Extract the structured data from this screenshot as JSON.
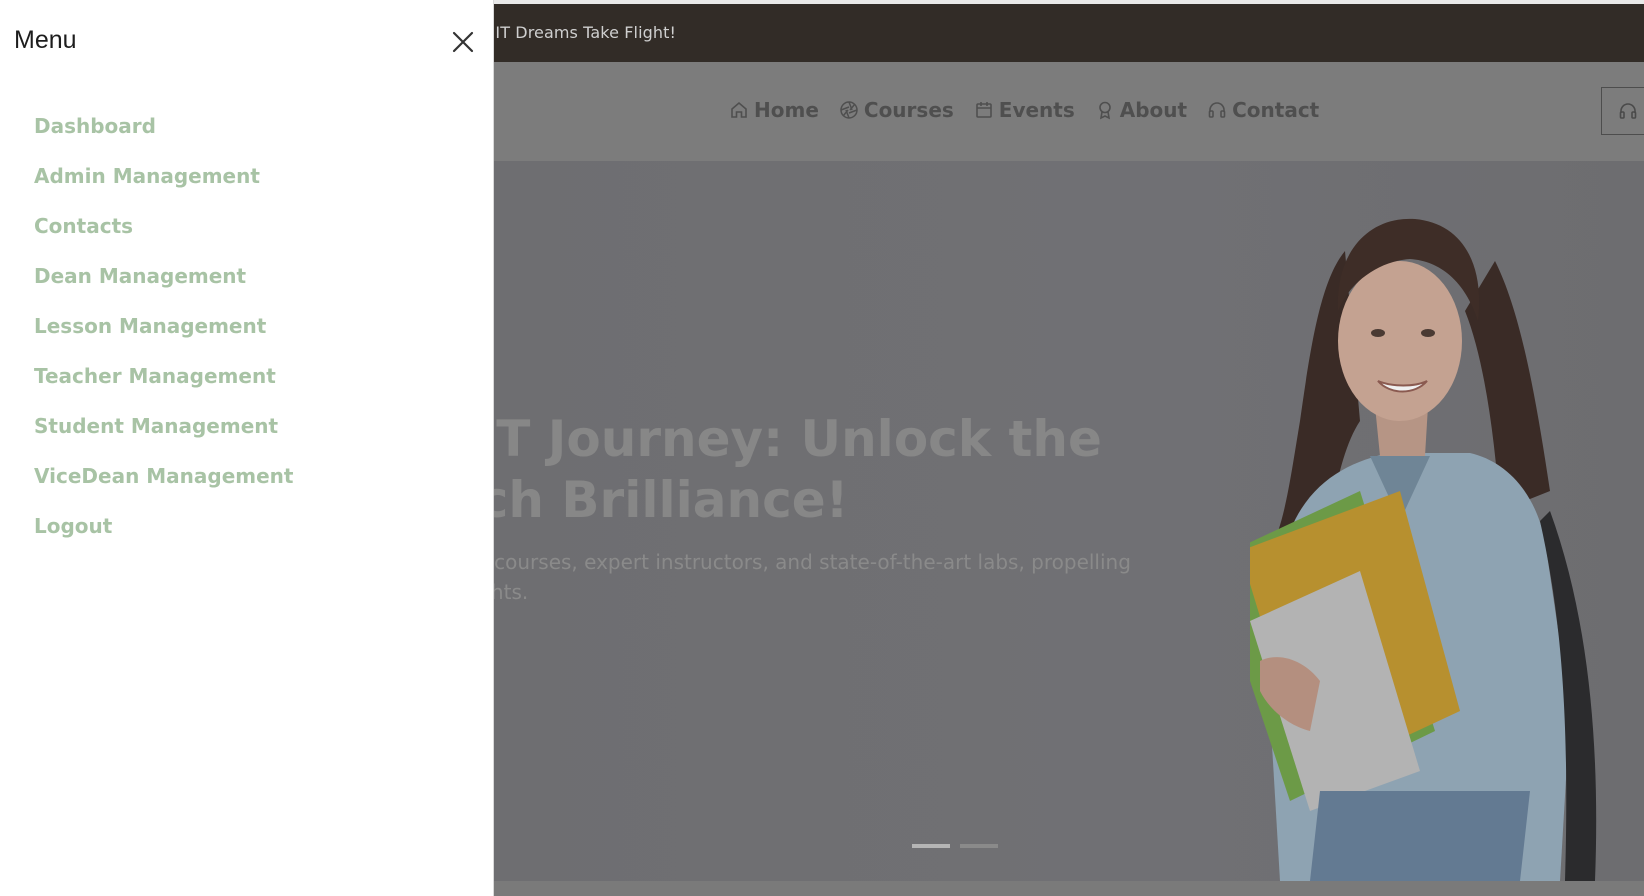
{
  "topbar": {
    "tagline": "ere IT Dreams Take Flight!"
  },
  "nav": {
    "items": [
      {
        "label": "Home",
        "icon": "home-icon"
      },
      {
        "label": "Courses",
        "icon": "aperture-icon"
      },
      {
        "label": "Events",
        "icon": "calendar-icon"
      },
      {
        "label": "About",
        "icon": "award-icon"
      },
      {
        "label": "Contact",
        "icon": "headset-icon"
      }
    ],
    "header_button_icon": "headset-icon"
  },
  "hero": {
    "title_line1": "ur IT Journey: Unlock the",
    "title_line2": " Tech Brilliance!",
    "subtitle_line1": "nge of IT courses, expert instructors, and state-of-the-art labs, propelling",
    "subtitle_line2": "new heights.",
    "slides": {
      "count": 2,
      "active": 1
    }
  },
  "menu": {
    "title": "Menu",
    "close_icon": "close-icon",
    "items": [
      "Dashboard",
      "Admin Management",
      "Contacts",
      "Dean Management",
      "Lesson Management",
      "Teacher Management",
      "Student Management",
      "ViceDean Management",
      "Logout"
    ]
  },
  "colors": {
    "menu_item": "#a8c3a5",
    "topbar_bg": "#322c27",
    "overlay": "#6f6f72"
  }
}
